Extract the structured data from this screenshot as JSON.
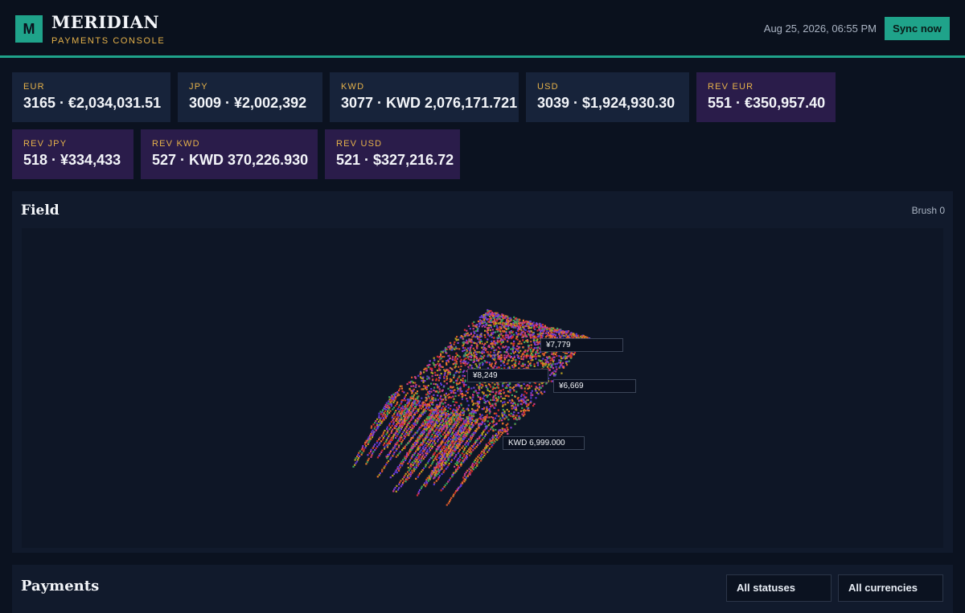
{
  "brand": {
    "logo_letter": "M",
    "name": "MERIDIAN",
    "subtitle": "PAYMENTS CONSOLE"
  },
  "header": {
    "datetime": "Aug 25, 2026, 06:55 PM",
    "sync_label": "Sync now"
  },
  "stats": [
    {
      "label": "EUR",
      "value": "3165 · €2,034,031.51"
    },
    {
      "label": "JPY",
      "value": "3009 · ¥2,002,392"
    },
    {
      "label": "KWD",
      "value": "3077 · KWD 2,076,171.721"
    },
    {
      "label": "USD",
      "value": "3039 · $1,924,930.30"
    },
    {
      "label": "REV EUR",
      "value": "551 · €350,957.40"
    },
    {
      "label": "REV JPY",
      "value": "518 · ¥334,433"
    },
    {
      "label": "REV KWD",
      "value": "527 · KWD 370,226.930"
    },
    {
      "label": "REV USD",
      "value": "521 · $327,216.72"
    }
  ],
  "field": {
    "title": "Field",
    "brush": "Brush 0",
    "tooltips": [
      "¥7,779",
      "¥8,249",
      "¥6,669",
      "KWD 6,999.000"
    ],
    "colors": [
      "#d02a2a",
      "#7c3fd6",
      "#e6742a",
      "#3aa05a",
      "#c93a8a",
      "#b8a020",
      "#5a3ad0",
      "#d4552a"
    ]
  },
  "payments": {
    "title": "Payments",
    "status_filter": "All statuses",
    "currency_filter": "All currencies"
  }
}
